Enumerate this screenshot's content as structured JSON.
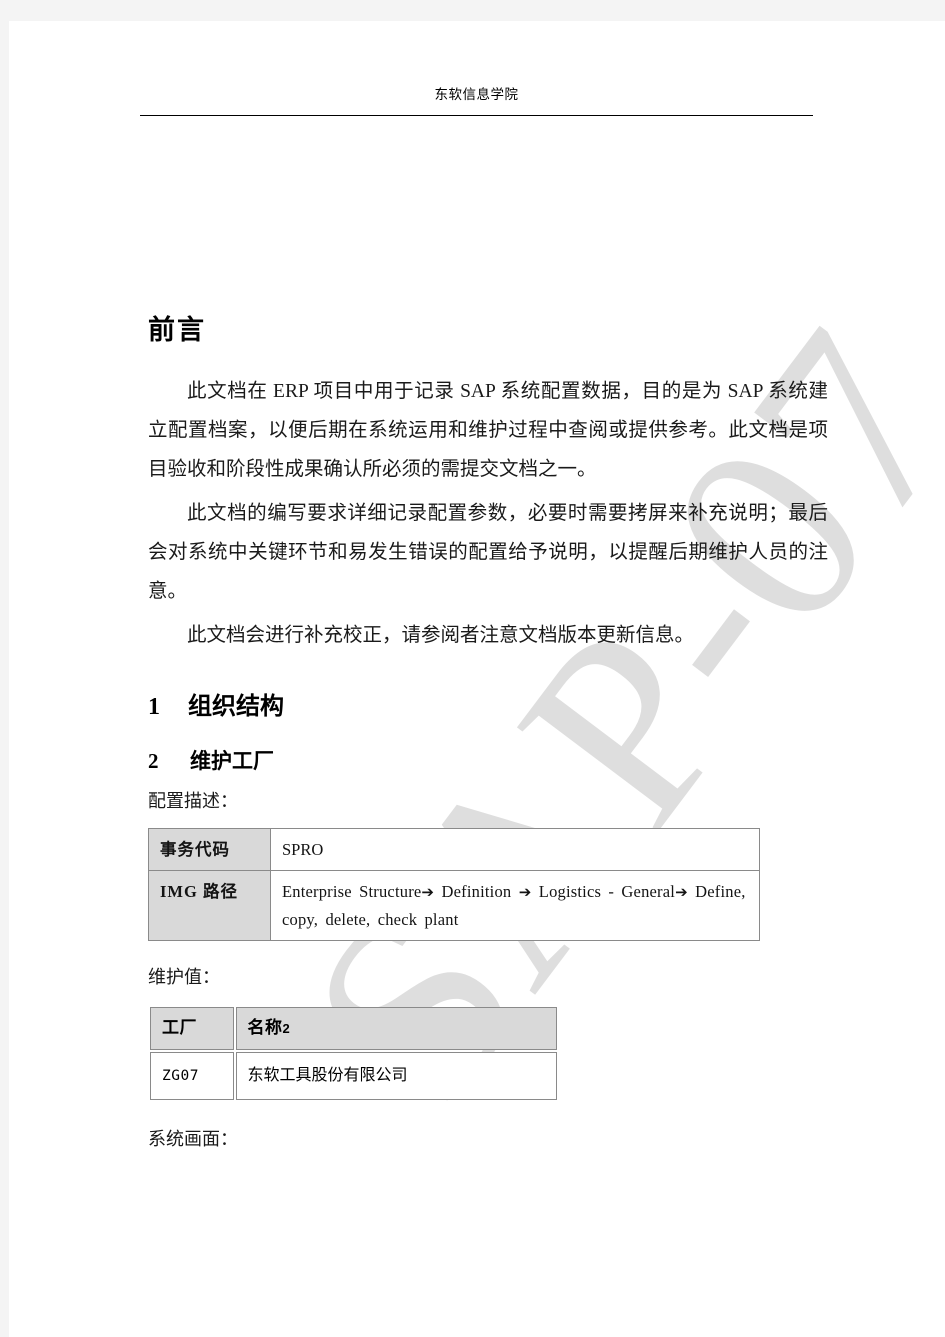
{
  "header": {
    "title": "东软信息学院"
  },
  "watermark": {
    "text": "SAP-07",
    "color": "#dedede"
  },
  "preface": {
    "heading": "前言",
    "paragraphs": [
      "此文档在 ERP 项目中用于记录 SAP 系统配置数据，目的是为 SAP 系统建立配置档案，以便后期在系统运用和维护过程中查阅或提供参考。此文档是项目验收和阶段性成果确认所必须的需提交文档之一。",
      "此文档的编写要求详细记录配置参数，必要时需要拷屏来补充说明；最后会对系统中关键环节和易发生错误的配置给予说明，以提醒后期维护人员的注意。",
      "此文档会进行补充校正，请参阅者注意文档版本更新信息。"
    ]
  },
  "sections": [
    {
      "number": "1",
      "title": "组织结构"
    },
    {
      "number": "2",
      "title": "维护工厂"
    }
  ],
  "config_description": {
    "caption": "配置描述：",
    "rows": [
      {
        "label": "事务代码",
        "value": "SPRO"
      },
      {
        "label": "IMG  路径",
        "value": "Enterprise  Structure→ Definition  →  Logistics  -  General→ Define, copy, delete, check plant"
      }
    ],
    "path_parts": {
      "p1": "Enterprise  Structure",
      "a1": "➔",
      "p2": " Definition  ",
      "a2": "➔",
      "p3": "  Logistics  -  General",
      "a3": "➔",
      "p4": " Define, copy, delete, check plant"
    }
  },
  "maintained_values": {
    "caption": "维护值：",
    "columns": [
      "工厂",
      "名称"
    ],
    "column_suffix": "2",
    "rows": [
      {
        "plant": "ZG07",
        "name": "东软工具股份有限公司"
      }
    ]
  },
  "system_screen": {
    "caption": "系统画面："
  },
  "colors": {
    "page_background": "#ffffff",
    "canvas_background": "#f4f4f4",
    "table_header_fill": "#d9d9d9",
    "table_border": "#8a8a8a",
    "text": "#1a1a1a"
  }
}
